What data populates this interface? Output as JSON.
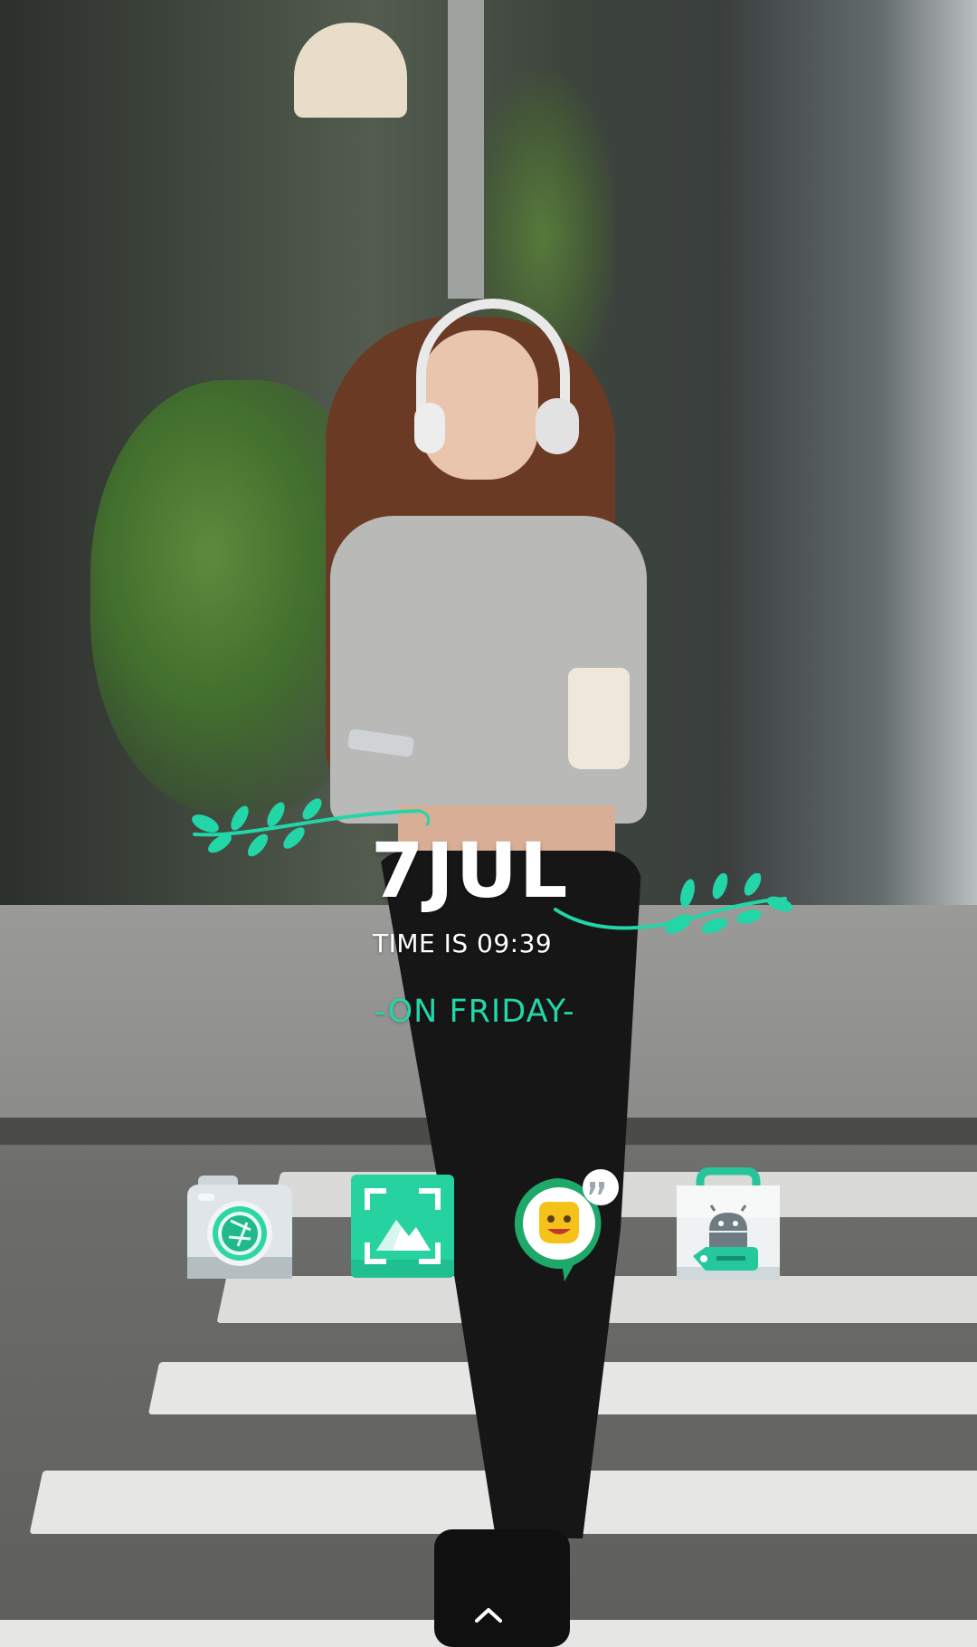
{
  "widget": {
    "date": "7JUL",
    "time_line": "TIME IS 09:39",
    "day_line": "-ON FRIDAY-",
    "accent_color": "#22d6a8",
    "text_color": "#ffffff"
  },
  "dock": {
    "apps": [
      {
        "icon": "camera-icon"
      },
      {
        "icon": "gallery-scan-icon"
      },
      {
        "icon": "emoji-chat-icon"
      },
      {
        "icon": "android-store-icon"
      }
    ]
  },
  "swipe_hint": {
    "icon": "chevron-up-icon"
  }
}
